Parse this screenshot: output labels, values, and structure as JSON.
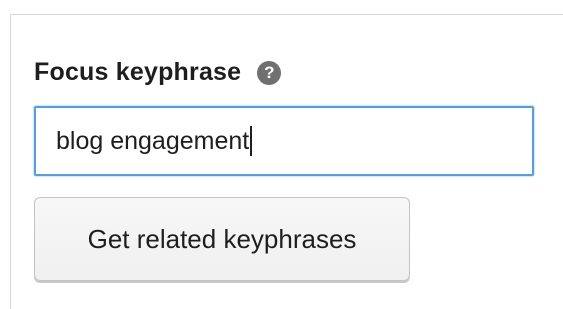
{
  "focus_keyphrase": {
    "label": "Focus keyphrase",
    "help_icon": "question-mark-icon",
    "help_glyph": "?",
    "input_value": "blog engagement"
  },
  "related_button": {
    "label": "Get related keyphrases"
  },
  "colors": {
    "input_focus_border": "#5b9dd9",
    "help_icon_bg": "#707070",
    "button_bg": "#f7f7f7"
  }
}
